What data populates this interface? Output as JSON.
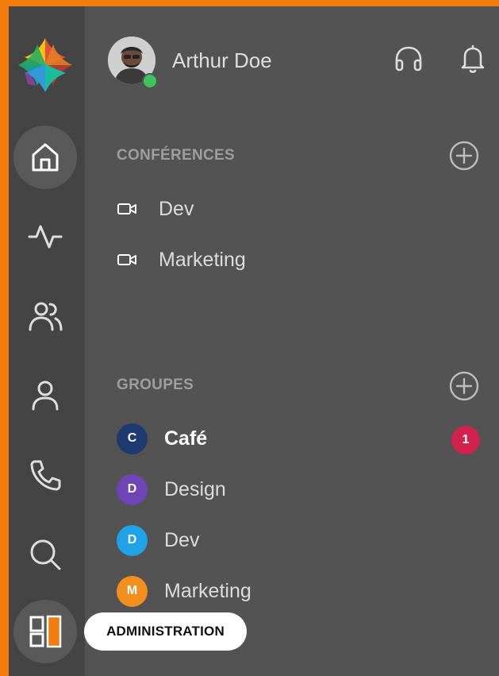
{
  "user": {
    "name": "Arthur Doe",
    "status": "online"
  },
  "sections": {
    "conferences": {
      "title": "CONFÉRENCES",
      "items": [
        {
          "label": "Dev",
          "icon": "video-icon"
        },
        {
          "label": "Marketing",
          "icon": "video-icon"
        }
      ]
    },
    "groups": {
      "title": "GROUPES",
      "items": [
        {
          "label": "Café",
          "initial": "C",
          "color": "#1e3a6e",
          "unread": "1",
          "bold": true
        },
        {
          "label": "Design",
          "initial": "D",
          "color": "#6f44b6"
        },
        {
          "label": "Dev",
          "initial": "D",
          "color": "#1fa2e6"
        },
        {
          "label": "Marketing",
          "initial": "M",
          "color": "#f48f1e"
        }
      ]
    }
  },
  "rail": {
    "items": [
      "home-icon",
      "activity-icon",
      "contacts-icon",
      "profile-icon",
      "phone-icon",
      "search-icon",
      "administration-icon"
    ],
    "tooltip": "ADMINISTRATION"
  },
  "colors": {
    "accent": "#f27d0c",
    "rail": "#444444",
    "panel": "#535353",
    "unread_badge": "#d1234e",
    "presence": "#3ec35e"
  }
}
